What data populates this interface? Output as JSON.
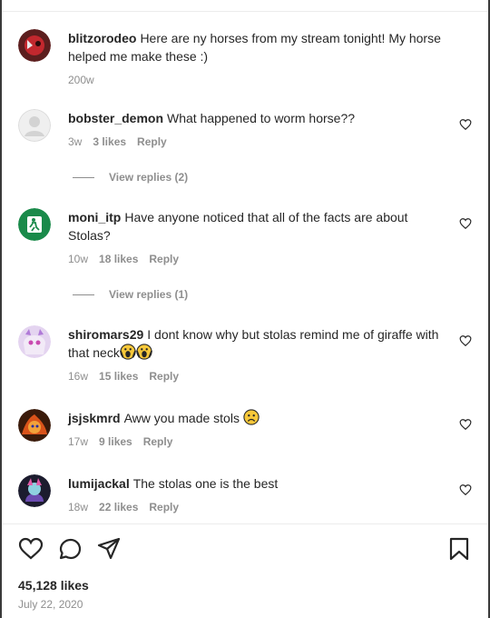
{
  "comments": [
    {
      "username": "blitzorodeo",
      "text": "Here are ny horses from my stream tonight! My horse helped me make these :)",
      "time": "200w"
    },
    {
      "username": "bobster_demon",
      "text": "What happened to worm horse??",
      "time": "3w",
      "likes": "3 likes",
      "reply": "Reply"
    },
    {
      "username": "moni_itp",
      "text": "Have anyone noticed that all of the facts are about Stolas?",
      "time": "10w",
      "likes": "18 likes",
      "reply": "Reply"
    },
    {
      "username": "shiromars29",
      "text": "I dont know why but stolas remind me of giraffe with that neck",
      "time": "16w",
      "likes": "15 likes",
      "reply": "Reply",
      "emoji": "screaming-face-icon"
    },
    {
      "username": "jsjskmrd",
      "text": "Aww you made stols",
      "time": "17w",
      "likes": "9 likes",
      "reply": "Reply",
      "emoji": "sad-face-icon"
    },
    {
      "username": "lumijackal",
      "text": "The stolas one is the best",
      "time": "18w",
      "likes": "22 likes",
      "reply": "Reply"
    }
  ],
  "view_replies": [
    "View replies (2)",
    "View replies (1)"
  ],
  "post": {
    "likes": "45,128 likes",
    "date": "July 22, 2020"
  },
  "colors": {
    "text": "#262626",
    "secondary": "#8e8e8e",
    "divider": "#ececec"
  }
}
